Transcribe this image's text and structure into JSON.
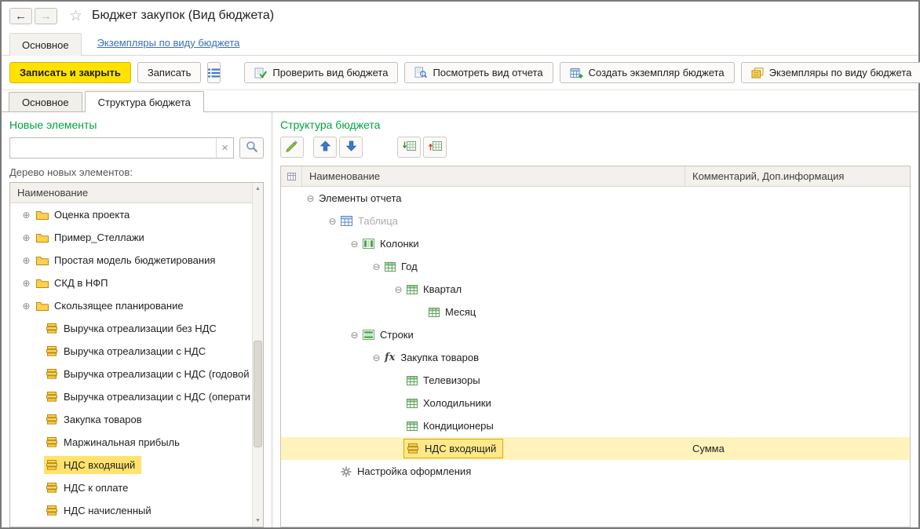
{
  "window": {
    "title": "Бюджет закупок (Вид бюджета)"
  },
  "header_nav": {
    "main_tab": "Основное",
    "instances_link": "Экземпляры по виду бюджета"
  },
  "command_bar": {
    "save_close": "Записать и закрыть",
    "save": "Записать",
    "check": "Проверить вид бюджета",
    "view_report": "Посмотреть вид отчета",
    "create_instance": "Создать экземпляр бюджета",
    "instances": "Экземпляры по виду бюджета"
  },
  "form_tabs": [
    {
      "label": "Основное",
      "active": false
    },
    {
      "label": "Структура бюджета",
      "active": true
    }
  ],
  "icons": {
    "back": "back-arrow-icon",
    "forward": "forward-arrow-icon",
    "favorite": "star-icon",
    "list": "list-icon",
    "check": "check-budget-icon",
    "view": "view-report-icon",
    "create": "create-instance-icon",
    "instances": "instances-icon",
    "search": "magnifier-icon",
    "clear": "clear-icon",
    "edit": "pencil-icon",
    "move_up": "arrow-up-icon",
    "move_down": "arrow-down-icon",
    "expand_all": "expand-all-icon",
    "collapse_all": "collapse-all-icon",
    "settings": "gear-icon"
  },
  "left_panel": {
    "title": "Новые элементы",
    "search": {
      "value": "",
      "placeholder": ""
    },
    "tree_caption": "Дерево новых элементов:",
    "column_header": "Наименование",
    "items": [
      {
        "label": "Оценка проекта",
        "icon": "folder",
        "expander": "plus"
      },
      {
        "label": "Пример_Стеллажи",
        "icon": "folder",
        "expander": "plus"
      },
      {
        "label": "Простая модель бюджетирования",
        "icon": "folder",
        "expander": "plus"
      },
      {
        "label": "СКД в НФП",
        "icon": "folder",
        "expander": "plus"
      },
      {
        "label": "Скользящее планирование",
        "icon": "folder",
        "expander": "plus"
      },
      {
        "label": "Выручка отреализации без НДС",
        "icon": "element",
        "expander": "none"
      },
      {
        "label": "Выручка отреализации с НДС",
        "icon": "element",
        "expander": "none"
      },
      {
        "label": "Выручка отреализации с НДС (годовой",
        "icon": "element",
        "expander": "none"
      },
      {
        "label": "Выручка отреализации с НДС (операти",
        "icon": "element",
        "expander": "none"
      },
      {
        "label": "Закупка товаров",
        "icon": "element",
        "expander": "none"
      },
      {
        "label": "Маржинальная прибыль",
        "icon": "element",
        "expander": "none"
      },
      {
        "label": "НДС входящий",
        "icon": "element",
        "expander": "none",
        "selected": true
      },
      {
        "label": "НДС к оплате",
        "icon": "element",
        "expander": "none"
      },
      {
        "label": "НДС начисленный",
        "icon": "element",
        "expander": "none"
      }
    ]
  },
  "right_panel": {
    "title": "Структура бюджета",
    "columns": {
      "name": "Наименование",
      "comment": "Комментарий, Доп.информация"
    },
    "rows": [
      {
        "label": "Элементы отчета",
        "level": 0,
        "expander": "minus",
        "icon": "none",
        "comment": ""
      },
      {
        "label": "Таблица",
        "level": 1,
        "expander": "minus",
        "icon": "table",
        "muted": true,
        "comment": ""
      },
      {
        "label": "Колонки",
        "level": 2,
        "expander": "minus",
        "icon": "columns",
        "comment": ""
      },
      {
        "label": "Год",
        "level": 3,
        "expander": "minus",
        "icon": "grid",
        "comment": ""
      },
      {
        "label": "Квартал",
        "level": 4,
        "expander": "minus",
        "icon": "grid",
        "comment": ""
      },
      {
        "label": "Месяц",
        "level": 5,
        "expander": "none",
        "icon": "grid",
        "comment": ""
      },
      {
        "label": "Строки",
        "level": 2,
        "expander": "minus",
        "icon": "rows",
        "comment": ""
      },
      {
        "label": "Закупка товаров",
        "level": 3,
        "expander": "minus",
        "icon": "fx",
        "comment": ""
      },
      {
        "label": "Телевизоры",
        "level": 4,
        "expander": "none",
        "icon": "grid",
        "comment": ""
      },
      {
        "label": "Холодильники",
        "level": 4,
        "expander": "none",
        "icon": "grid",
        "comment": ""
      },
      {
        "label": "Кондиционеры",
        "level": 4,
        "expander": "none",
        "icon": "grid",
        "comment": ""
      },
      {
        "label": "НДС входящий",
        "level": 4,
        "expander": "none",
        "icon": "element",
        "selected": true,
        "comment": "Сумма"
      },
      {
        "label": "Настройка оформления",
        "level": 1,
        "expander": "none",
        "icon": "gear",
        "comment": ""
      }
    ]
  }
}
